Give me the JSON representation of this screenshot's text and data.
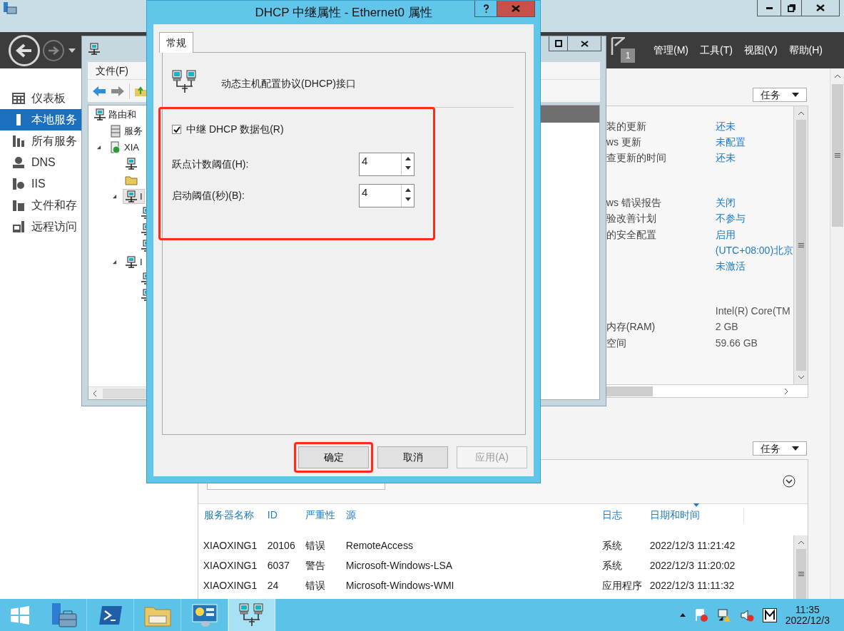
{
  "server_manager": {
    "menus": [
      "管理(M)",
      "工具(T)",
      "视图(V)",
      "帮助(H)"
    ],
    "flag_count": "1",
    "nav": [
      {
        "label": "仪表板",
        "kind": "dashboard",
        "selected": false
      },
      {
        "label": "本地服务",
        "kind": "server",
        "selected": true
      },
      {
        "label": "所有服务",
        "kind": "servers",
        "selected": false
      },
      {
        "label": "DNS",
        "kind": "dns",
        "selected": false
      },
      {
        "label": "IIS",
        "kind": "iis",
        "selected": false
      },
      {
        "label": "文件和存",
        "kind": "files",
        "selected": false
      },
      {
        "label": "远程访问",
        "kind": "remote",
        "selected": false
      }
    ],
    "tasks_top": "任务",
    "property_groups": [
      [
        {
          "label": "装的更新",
          "value": "还未"
        },
        {
          "label": "ws 更新",
          "value": "未配置"
        },
        {
          "label": "查更新的时间",
          "value": "还未"
        }
      ],
      [
        {
          "label": "ws 错误报告",
          "value": "关闭"
        },
        {
          "label": "验改善计划",
          "value": "不参与"
        },
        {
          "label": "的安全配置",
          "value": "启用"
        },
        {
          "value": "(UTC+08:00)北京"
        },
        {
          "value": "未激活"
        }
      ],
      [
        {
          "value": "Intel(R) Core(TM"
        },
        {
          "label": "内存(RAM)",
          "value": "2 GB"
        },
        {
          "label": "空间",
          "value": "59.66 GB"
        }
      ]
    ],
    "tasks_bottom": "任务",
    "events": {
      "columns": [
        "服务器名称",
        "ID",
        "严重性",
        "源",
        "日志",
        "日期和时间"
      ],
      "rows": [
        [
          "XIAOXING1",
          "20106",
          "错误",
          "RemoteAccess",
          "系统",
          "2022/12/3 11:21:42"
        ],
        [
          "XIAOXING1",
          "6037",
          "警告",
          "Microsoft-Windows-LSA",
          "系统",
          "2022/12/3 11:20:02"
        ],
        [
          "XIAOXING1",
          "24",
          "错误",
          "Microsoft-Windows-WMI",
          "应用程序",
          "2022/12/3 11:11:32"
        ]
      ]
    }
  },
  "rras": {
    "menu": [
      "文件(F)"
    ],
    "tree": [
      {
        "label": "路由和",
        "kind": "router",
        "selected": false,
        "children": [
          {
            "label": "服务",
            "kind": "servers",
            "selected": false
          },
          {
            "label": "XIA",
            "kind": "server",
            "selected": false,
            "expanded": true,
            "children": [
              {
                "kind": "router",
                "selected": false
              },
              {
                "kind": "folder",
                "selected": false
              },
              {
                "label": "I",
                "kind": "router",
                "selected": true,
                "expanded": true,
                "children": [
                  {
                    "kind": "router",
                    "selected": false
                  },
                  {
                    "kind": "router",
                    "selected": false
                  },
                  {
                    "kind": "router",
                    "selected": false
                  }
                ]
              },
              {
                "label": "I",
                "kind": "router",
                "selected": false,
                "expanded": true,
                "children": [
                  {
                    "kind": "router",
                    "selected": false
                  },
                  {
                    "kind": "router",
                    "selected": false
                  }
                ]
              }
            ]
          }
        ]
      }
    ]
  },
  "dialog": {
    "title": "DHCP 中继属性 - Ethernet0 属性",
    "tabs": [
      {
        "label": "常规",
        "selected": true
      }
    ],
    "heading": "动态主机配置协议(DHCP)接口",
    "relay": {
      "label": "中继 DHCP 数据包(R)",
      "checked": true
    },
    "fields": [
      {
        "label": "跃点计数阈值(H):",
        "value": "4"
      },
      {
        "label": "启动阈值(秒)(B):",
        "value": "4"
      }
    ],
    "buttons": [
      {
        "label": "确定",
        "disabled": false,
        "highlighted": true
      },
      {
        "label": "取消",
        "disabled": false,
        "highlighted": false
      },
      {
        "label": "应用(A)",
        "disabled": true,
        "highlighted": false
      }
    ],
    "settings_highlighted": true
  },
  "taskbar": {
    "apps": [
      {
        "kind": "server-manager",
        "selected": false
      },
      {
        "kind": "powershell",
        "selected": false
      },
      {
        "kind": "explorer",
        "selected": false
      },
      {
        "kind": "control-panel",
        "selected": false
      },
      {
        "kind": "network",
        "selected": true
      }
    ],
    "time": "11:35",
    "date": "2022/12/3"
  }
}
